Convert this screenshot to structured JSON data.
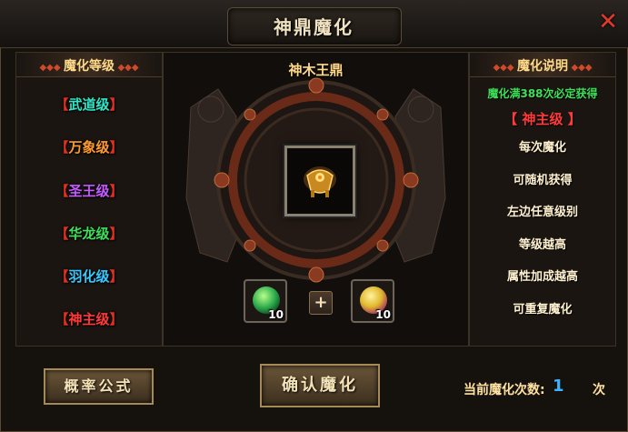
{
  "title": "神鼎魔化",
  "left_panel": {
    "header": "魔化等级",
    "levels": [
      {
        "label": "武道级",
        "color": "#2ee6c8"
      },
      {
        "label": "万象级",
        "color": "#ff9a2e"
      },
      {
        "label": "圣王级",
        "color": "#c45cff"
      },
      {
        "label": "华龙级",
        "color": "#3ee05a"
      },
      {
        "label": "羽化级",
        "color": "#36c8ff"
      },
      {
        "label": "神主级",
        "color": "#ff3a3a"
      }
    ],
    "bracket_left": "【",
    "bracket_right": "】"
  },
  "center": {
    "title": "神木王鼎",
    "material_1_count": "10",
    "material_2_count": "10",
    "plus_label": "+",
    "main_slot_icon": "golden-cauldron-icon",
    "material_1_icon": "green-orb-icon",
    "material_2_icon": "yellow-orb-icon"
  },
  "right_panel": {
    "header": "魔化说明",
    "guarantee": "魔化满388次必定获得",
    "level_name": "【 神主级 】",
    "lines": [
      "每次魔化",
      "可随机获得",
      "左边任意级别",
      "等级越高",
      "属性加成越高",
      "可重复魔化"
    ]
  },
  "bottom": {
    "formula_button": "概率公式",
    "confirm_button": "确认魔化",
    "count_label": "当前魔化次数:",
    "count_value": "1",
    "count_unit": "次"
  },
  "colors": {
    "accent_gold": "#ffd98a",
    "guarantee_green": "#3ee05a",
    "level_red": "#ff3a3a",
    "count_blue": "#3db3ff"
  }
}
